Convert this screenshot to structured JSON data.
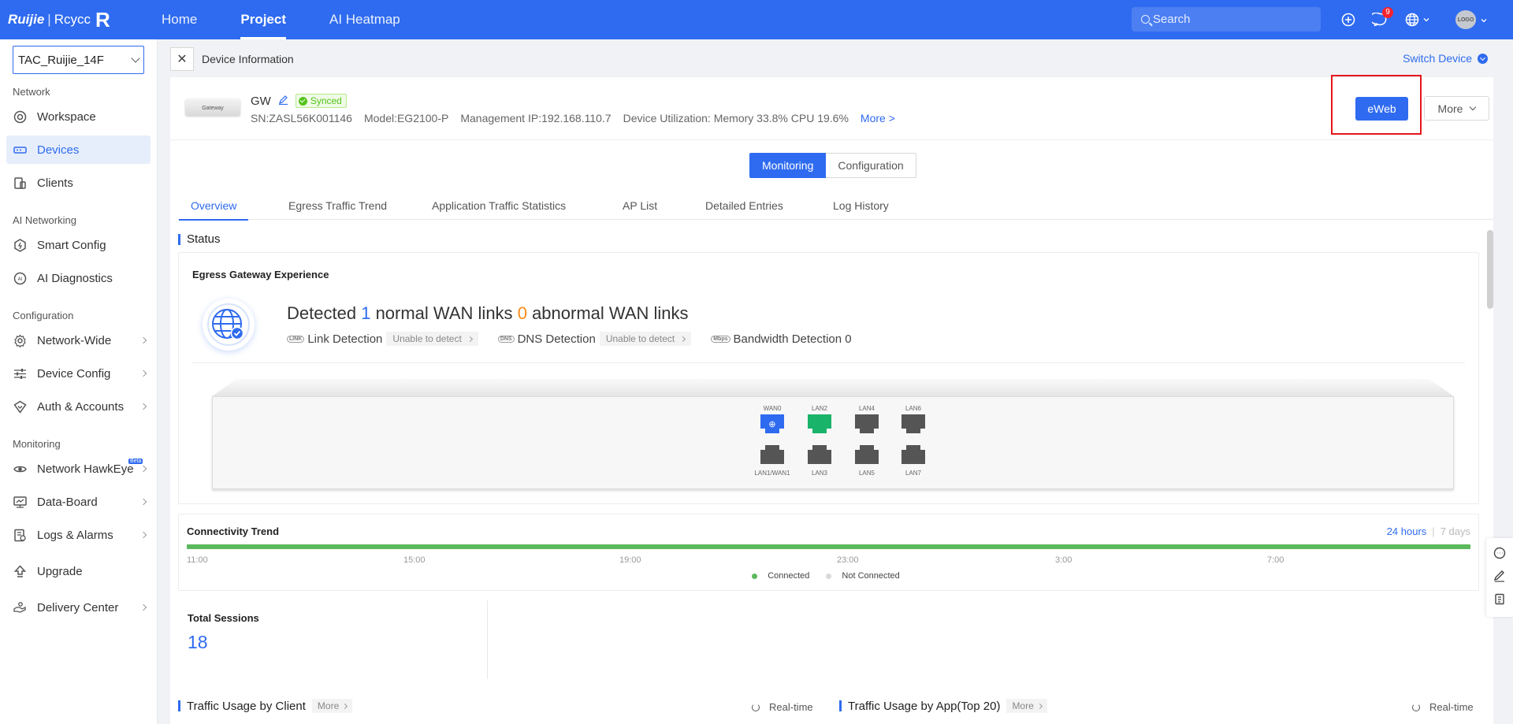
{
  "brand": {
    "logo_left": "Ruijie",
    "logo_right": "Rcycc",
    "mark": "R"
  },
  "topnav": {
    "items": [
      {
        "label": "Home",
        "active": false
      },
      {
        "label": "Project",
        "active": true
      },
      {
        "label": "AI Heatmap",
        "active": false
      }
    ],
    "search_placeholder": "Search",
    "notification_count": "9",
    "avatar_text": "LOGO"
  },
  "sidebar": {
    "site": "TAC_Ruijie_14F",
    "groups": [
      {
        "label": "Network"
      },
      {
        "label": "AI Networking"
      },
      {
        "label": "Configuration"
      },
      {
        "label": "Monitoring"
      }
    ],
    "items": {
      "workspace": "Workspace",
      "devices": "Devices",
      "clients": "Clients",
      "smart_config": "Smart Config",
      "ai_diagnostics": "AI Diagnostics",
      "network_wide": "Network-Wide",
      "device_config": "Device Config",
      "auth_accounts": "Auth & Accounts",
      "network_hawkeye": "Network HawkEye",
      "hawkeye_badge": "Beta",
      "data_board": "Data-Board",
      "logs_alarms": "Logs & Alarms",
      "upgrade": "Upgrade",
      "delivery_center": "Delivery Center"
    }
  },
  "page": {
    "title": "Device Information",
    "switch_device": "Switch Device"
  },
  "device": {
    "image_label": "Gateway",
    "name": "GW",
    "status": "Synced",
    "sn": "SN:ZASL56K001146",
    "model": "Model:EG2100-P",
    "mgmt_ip": "Management IP:192.168.110.7",
    "utilization": "Device Utilization: Memory 33.8% CPU 19.6%",
    "more_link": "More >",
    "eweb_button": "eWeb",
    "more_button": "More"
  },
  "mode_switch": {
    "monitoring": "Monitoring",
    "configuration": "Configuration"
  },
  "tabs": [
    {
      "label": "Overview",
      "active": true
    },
    {
      "label": "Egress Traffic Trend",
      "active": false
    },
    {
      "label": "Application Traffic Statistics",
      "active": false
    },
    {
      "label": "AP List",
      "active": false
    },
    {
      "label": "Detailed Entries",
      "active": false
    },
    {
      "label": "Log History",
      "active": false
    }
  ],
  "status": {
    "section_title": "Status",
    "egress_title": "Egress Gateway Experience",
    "detected_prefix": "Detected",
    "normal_count": "1",
    "normal_text": "normal WAN links",
    "abnormal_count": "0",
    "abnormal_text": "abnormal WAN links",
    "link_icon": "LINK",
    "link_detection": "Link Detection",
    "link_result": "Unable to detect",
    "dns_icon": "DNS",
    "dns_detection": "DNS Detection",
    "dns_result": "Unable to detect",
    "bw_icon": "Mbps",
    "bandwidth_detection": "Bandwidth Detection 0"
  },
  "ports": {
    "top": [
      "WAN0",
      "LAN2",
      "LAN4",
      "LAN6"
    ],
    "bottom": [
      "LAN1/WAN1",
      "LAN3",
      "LAN5",
      "LAN7"
    ],
    "states": {
      "WAN0": "wan-connected",
      "LAN2": "connected"
    }
  },
  "connectivity": {
    "title": "Connectivity Trend",
    "range_24h": "24 hours",
    "range_7d": "7 days",
    "ticks": [
      "11:00",
      "15:00",
      "19:00",
      "23:00",
      "3:00",
      "7:00"
    ],
    "legend_connected": "Connected",
    "legend_not_connected": "Not Connected",
    "colors": {
      "connected": "#5cb85c",
      "not_connected": "#d9d9d9"
    }
  },
  "sessions": {
    "label": "Total Sessions",
    "value": "18"
  },
  "traffic": {
    "by_client": "Traffic Usage by Client",
    "by_app": "Traffic Usage by App(Top 20)",
    "more": "More",
    "realtime": "Real-time"
  },
  "colors": {
    "primary": "#2f6bf0",
    "highlight_box": "#e5161c",
    "synced": "#52c41a",
    "abnormal": "#fa8c16"
  }
}
